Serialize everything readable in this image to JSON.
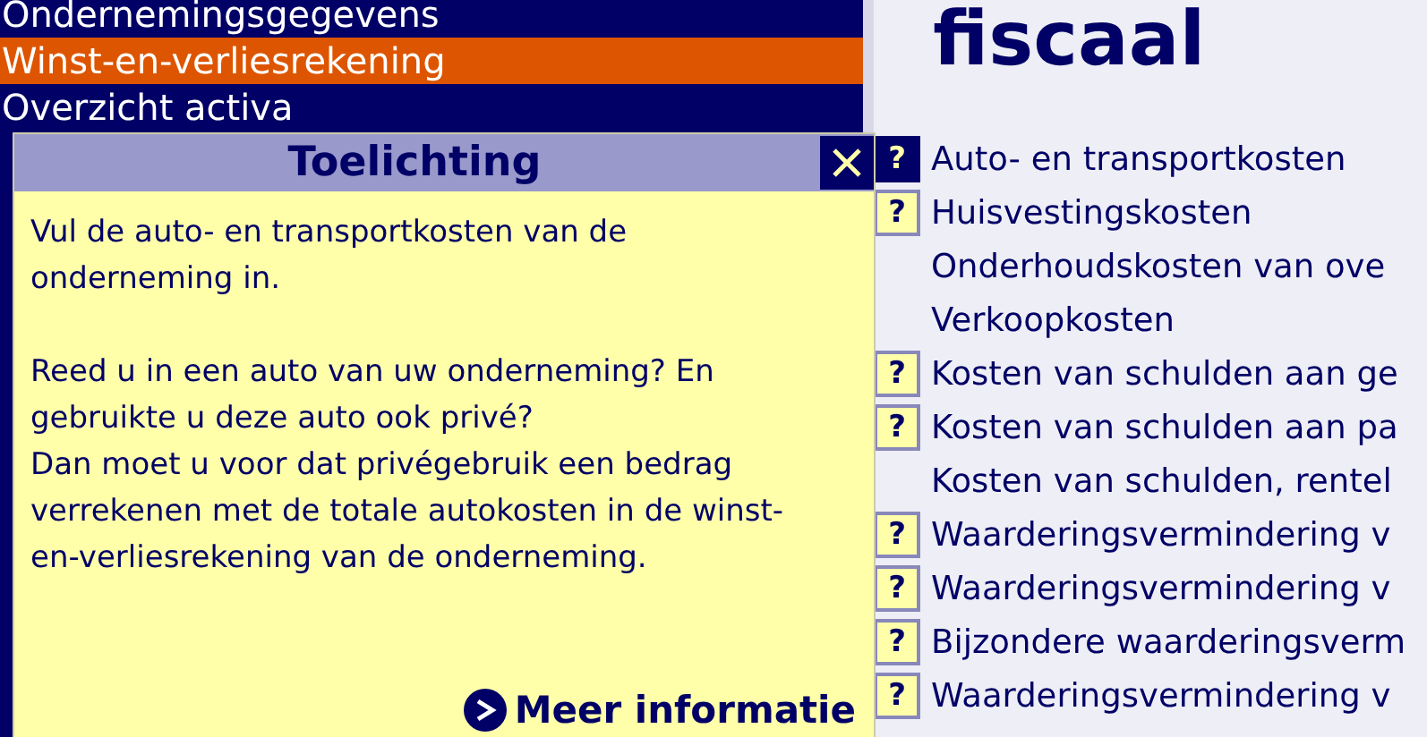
{
  "sidebar": {
    "items": [
      {
        "label": "Ondernemingsgegevens",
        "selected": false
      },
      {
        "label": "Winst-en-verliesrekening",
        "selected": true
      },
      {
        "label": "Overzicht activa",
        "selected": false
      }
    ]
  },
  "popup": {
    "title": "Toelichting",
    "paragraphs": [
      "Vul de auto- en transportkosten van de onderneming in.",
      "Reed u in een auto van uw onderneming? En gebruikte u deze auto ook privé?\nDan moet u voor dat privégebruik een bedrag verrekenen met de totale autokosten in de winst-en-verliesrekening van de onderneming."
    ],
    "link": "Meer informatie"
  },
  "content": {
    "heading": "fiscaal",
    "items": [
      {
        "label": "Auto- en transportkosten",
        "help": "?",
        "has_help": true,
        "selected": true
      },
      {
        "label": "Huisvestingskosten",
        "help": "?",
        "has_help": true,
        "selected": false
      },
      {
        "label": "Onderhoudskosten van ove",
        "has_help": false
      },
      {
        "label": "Verkoopkosten",
        "has_help": false
      },
      {
        "label": "Kosten van schulden aan ge",
        "help": "?",
        "has_help": true,
        "selected": false
      },
      {
        "label": "Kosten van schulden aan pa",
        "help": "?",
        "has_help": true,
        "selected": false
      },
      {
        "label": "Kosten van schulden, rentel",
        "has_help": false
      },
      {
        "label": "Waarderingsvermindering v",
        "help": "?",
        "has_help": true,
        "selected": false
      },
      {
        "label": "Waarderingsvermindering v",
        "help": "?",
        "has_help": true,
        "selected": false
      },
      {
        "label": "Bijzondere waarderingsverm",
        "help": "?",
        "has_help": true,
        "selected": false
      },
      {
        "label": "Waarderingsvermindering v",
        "help": "?",
        "has_help": true,
        "selected": false
      }
    ]
  }
}
